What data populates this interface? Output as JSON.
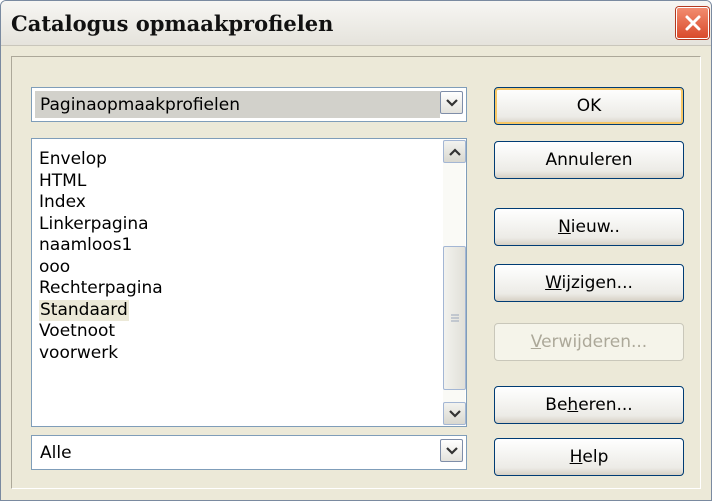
{
  "window": {
    "title": "Catalogus opmaakprofielen",
    "close_icon": "close-icon"
  },
  "style_type_combo": {
    "value": "Paginaopmaakprofielen"
  },
  "style_list": {
    "items": [
      {
        "label": "Envelop",
        "selected": false
      },
      {
        "label": "HTML",
        "selected": false
      },
      {
        "label": "Index",
        "selected": false
      },
      {
        "label": "Linkerpagina",
        "selected": false
      },
      {
        "label": "naamloos1",
        "selected": false
      },
      {
        "label": "ooo",
        "selected": false
      },
      {
        "label": "Rechterpagina",
        "selected": false
      },
      {
        "label": "Standaard",
        "selected": true
      },
      {
        "label": "Voetnoot",
        "selected": false
      },
      {
        "label": "voorwerk",
        "selected": false
      }
    ]
  },
  "filter_combo": {
    "value": "Alle"
  },
  "buttons": {
    "ok": {
      "label": "OK"
    },
    "cancel": {
      "label": "Annuleren"
    },
    "new": {
      "label_pre": "",
      "mnemonic": "N",
      "label_post": "ieuw.."
    },
    "modify": {
      "label_pre": "",
      "mnemonic": "W",
      "label_post": "ijzigen..."
    },
    "delete": {
      "label_pre": "",
      "mnemonic": "V",
      "label_post": "erwijderen..."
    },
    "manage": {
      "label_pre": "Be",
      "mnemonic": "h",
      "label_post": "eren..."
    },
    "help": {
      "label_pre": "",
      "mnemonic": "H",
      "label_post": "elp"
    }
  },
  "colors": {
    "accent": "#003c74",
    "dialog_bg": "#ece9d8",
    "close_red": "#d94a2b"
  }
}
